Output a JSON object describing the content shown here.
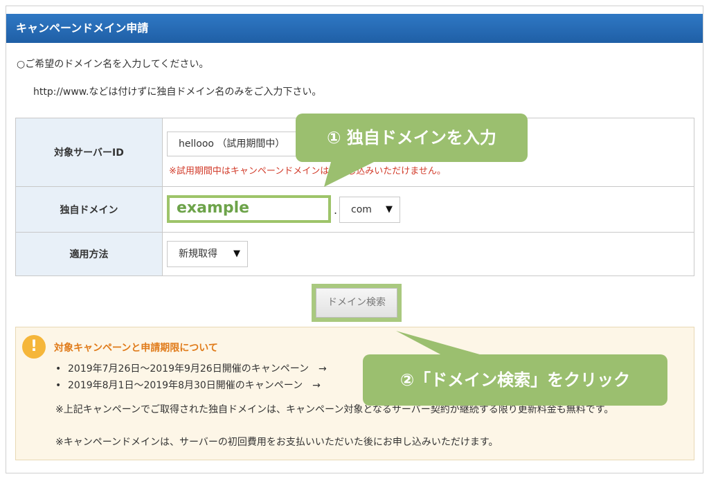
{
  "header": {
    "title": "キャンペーンドメイン申請"
  },
  "intro": {
    "line1": "○ご希望のドメイン名を入力してください。",
    "line2": "http://www.などは付けずに独自ドメイン名のみをご入力下さい。"
  },
  "form": {
    "server_label": "対象サーバーID",
    "server_value": "hellooo （試用期間中）",
    "server_warning": "※試用期間中はキャンペーンドメインはお申し込みいただけません。",
    "domain_label": "独自ドメイン",
    "domain_value": "example",
    "domain_dot": ".",
    "tld_selected": "com",
    "method_label": "適用方法",
    "method_selected": "新規取得",
    "dropdown_arrow": "▼"
  },
  "search_button": {
    "label": "ドメイン検索"
  },
  "campaign": {
    "icon": "!",
    "title": "対象キャンペーンと申請期限について",
    "items": [
      {
        "text": "2019年7月26日～2019年9月26日開催のキャンペーン　→"
      },
      {
        "text": "2019年8月1日～2019年8月30日開催のキャンペーン　→"
      }
    ],
    "note1": "※上記キャンペーンでご取得された独自ドメインは、キャンペーン対象となるサーバー契約が継続する限り更新料金も無料です。",
    "note2": "※キャンペーンドメインは、サーバーの初回費用をお支払いいただいた後にお申し込みいただけます。"
  },
  "callouts": {
    "step1": "① 独自ドメインを入力",
    "step2": "②「ドメイン検索」をクリック"
  },
  "colors": {
    "header_blue": "#1f5fa6",
    "callout_green": "#9bbf6f",
    "warning_red": "#d23b2a",
    "campaign_orange": "#e07b1a",
    "label_bg": "#e8f0f8"
  }
}
